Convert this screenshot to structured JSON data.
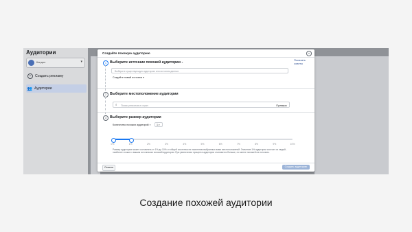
{
  "sidebar": {
    "title": "Аудитории",
    "account_name": "Кэндол",
    "account_initials": "K",
    "create_ad": "Создать рекламу",
    "audiences": "Аудитории"
  },
  "modal": {
    "title": "Создайте похожую аудиторию",
    "help_link": "Показать советы",
    "section1": {
      "step": "1",
      "title": "Выберите источник похожей аудитории",
      "placeholder": "Выберите существующую аудиторию или источник данных",
      "create_source": "Создайте новый источник"
    },
    "section2": {
      "step": "2",
      "title": "Выберите местоположение аудитории",
      "placeholder": "Поиск регионов и стран",
      "examples": "Примеры"
    },
    "section3": {
      "step": "3",
      "title": "Выберите размер аудитории",
      "count_label": "Количество похожих аудиторий",
      "count_value": "1",
      "slider_ticks": [
        "0%",
        "1%",
        "2%",
        "3%",
        "4%",
        "5%",
        "6%",
        "7%",
        "8%",
        "9%",
        "10%"
      ],
      "slider_value_percent": 1,
      "description": "Размер аудитории может составлять от 1% до 10% от общей численности населения выбранных вами местоположений. Значение 1% аудитории состоит из людей, наиболее схожих с вашим источником похожей аудитории. При увеличении процента аудитория становится больше, но менее похожей на источник."
    },
    "cancel_label": "Отмена",
    "create_label": "Создать аудиторию"
  },
  "caption": "Создание похожей аудитории"
}
